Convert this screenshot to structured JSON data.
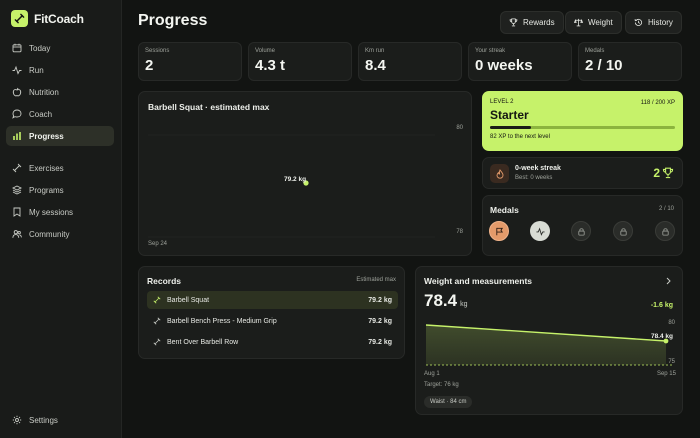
{
  "app": {
    "name": "FitCoach"
  },
  "nav_primary": [
    {
      "label": "Today",
      "icon": "calendar-icon"
    },
    {
      "label": "Run",
      "icon": "activity-icon"
    },
    {
      "label": "Nutrition",
      "icon": "apple-icon"
    },
    {
      "label": "Coach",
      "icon": "chat-icon"
    },
    {
      "label": "Progress",
      "icon": "bar-chart-icon",
      "active": true
    }
  ],
  "nav_secondary": [
    {
      "label": "Exercises",
      "icon": "dumbbell-icon"
    },
    {
      "label": "Programs",
      "icon": "layers-icon"
    },
    {
      "label": "My sessions",
      "icon": "bookmark-icon"
    },
    {
      "label": "Community",
      "icon": "users-icon"
    }
  ],
  "nav_footer": {
    "settings_label": "Settings"
  },
  "page": {
    "title": "Progress"
  },
  "header_buttons": {
    "rewards": "Rewards",
    "weight": "Weight",
    "history": "History"
  },
  "stats": [
    {
      "label": "Sessions",
      "value": "2"
    },
    {
      "label": "Volume",
      "value": "4.3 t"
    },
    {
      "label": "Km run",
      "value": "8.4"
    },
    {
      "label": "Your streak",
      "value": "0 weeks"
    },
    {
      "label": "Medals",
      "value": "2 / 10"
    }
  ],
  "estimate_chart": {
    "title": "Barbell Squat · estimated max",
    "y_top_label": "80",
    "y_bottom_label": "78",
    "x_label": "Sep 24",
    "point_label": "79.2 kg"
  },
  "level": {
    "label": "LEVEL 2",
    "xp": "118 / 200 XP",
    "rank": "Starter",
    "progress": 0.22,
    "next": "82 XP to the next level"
  },
  "streak": {
    "title": "0-week streak",
    "best": "Best: 0 weeks",
    "trophies": "2"
  },
  "medals": {
    "title": "Medals",
    "count": "2 / 10",
    "items": [
      {
        "icon": "flag-icon",
        "earned": true,
        "color": "#e39a6a"
      },
      {
        "icon": "activity-icon",
        "earned": true,
        "color": "#d8dcd4"
      },
      {
        "icon": "lock-icon",
        "earned": false
      },
      {
        "icon": "lock-icon",
        "earned": false
      },
      {
        "icon": "lock-icon",
        "earned": false
      }
    ]
  },
  "records": {
    "title": "Records",
    "subtitle": "Estimated max",
    "rows": [
      {
        "name": "Barbell Squat",
        "value": "79.2 kg",
        "active": true
      },
      {
        "name": "Barbell Bench Press - Medium Grip",
        "value": "79.2 kg"
      },
      {
        "name": "Bent Over Barbell Row",
        "value": "79.2 kg"
      }
    ]
  },
  "weight": {
    "title": "Weight and measurements",
    "current_value": "78.4",
    "current_unit": "kg",
    "delta": "-1.6 kg",
    "y_top_label": "80",
    "y_bottom_label": "75",
    "end_label": "78.4 kg",
    "x_start": "Aug 1",
    "x_end": "Sep 15",
    "target": "Target: 76 kg",
    "tag": "Waist · 84 cm"
  },
  "colors": {
    "accent": "#c6f26a",
    "background": "#121412",
    "card": "#1b1d1b"
  }
}
